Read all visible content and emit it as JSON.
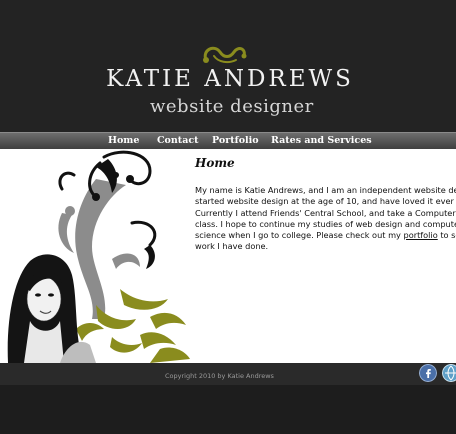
{
  "header": {
    "title": "KATIE ANDREWS",
    "subtitle": "website designer"
  },
  "nav": {
    "items": [
      "Home",
      "Contact",
      "Portfolio",
      "Rates and Services"
    ]
  },
  "main": {
    "heading": "Home",
    "paragraph_part1": "My name is Katie Andrews, and I am an independent website designer. I started website design at the age of 10, and have loved it ever since. Currently I attend Friends' Central School, and take a Computer Science class. I hope to continue my studies of web design and computer science when I go to college. Please check out my ",
    "portfolio_link": "portfolio",
    "paragraph_part2": " to see the work I have done."
  },
  "footer": {
    "copyright": "Copyright 2010 by Katie Andrews"
  },
  "icons": {
    "ornament": "swirl-ornament-icon",
    "facebook": "facebook-icon",
    "social2": "globe-icon"
  },
  "colors": {
    "accent_olive": "#8a8c1e",
    "header_bg": "#232323",
    "content_bg": "#ffffff"
  }
}
